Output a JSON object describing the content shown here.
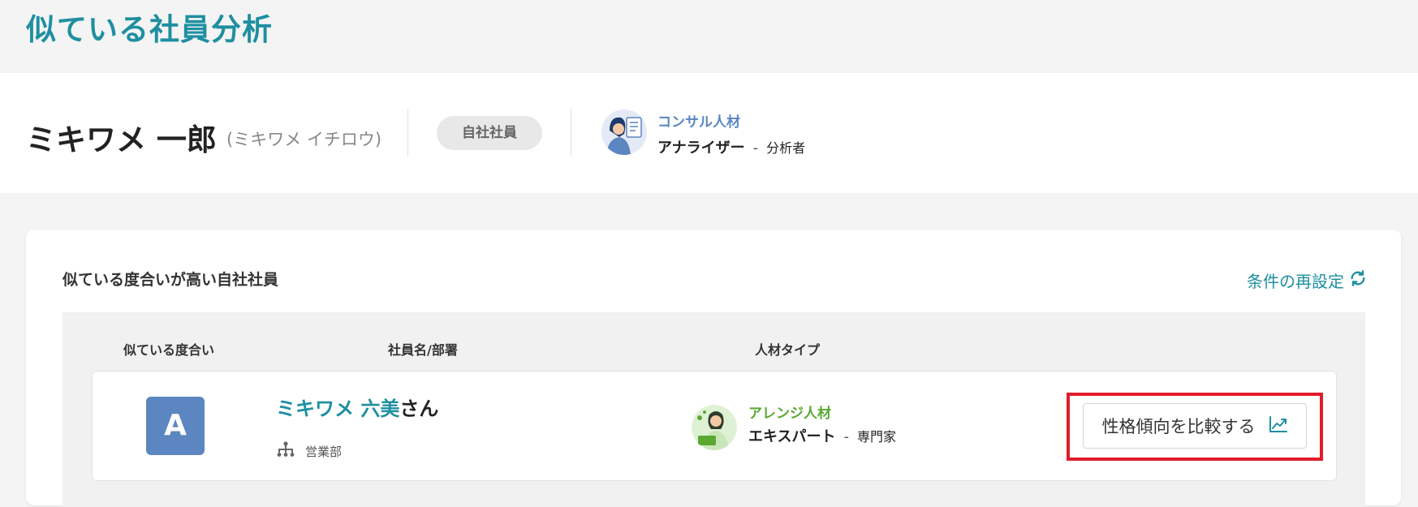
{
  "page": {
    "title": "似ている社員分析"
  },
  "profile": {
    "name": "ミキワメ 一郎",
    "kana": "(ミキワメ イチロウ)",
    "badge": "自社社員",
    "type": {
      "name": "コンサル人材",
      "subtype": "アナライザー",
      "separator": "-",
      "role": "分析者",
      "color": "#5b86c1",
      "icon": "consultant-avatar"
    }
  },
  "similar": {
    "title": "似ている度合いが高い自社社員",
    "reset_label": "条件の再設定",
    "reset_icon": "refresh-icon",
    "columns": [
      "似ている度合い",
      "社員名/部署",
      "人材タイプ"
    ],
    "rows": [
      {
        "grade": "A",
        "name": "ミキワメ 六美",
        "suffix": "さん",
        "department": "営業部",
        "department_icon": "org-chart-icon",
        "type": {
          "name": "アレンジ人材",
          "subtype": "エキスパート",
          "separator": "-",
          "role": "専門家",
          "color": "#5aa832",
          "icon": "arrange-avatar"
        },
        "compare_label": "性格傾向を比較する",
        "compare_icon": "trend-chart-icon"
      }
    ]
  },
  "colors": {
    "accent": "#1e8fa0",
    "grade_bg": "#5b86c1",
    "highlight": "#e11d2a"
  }
}
